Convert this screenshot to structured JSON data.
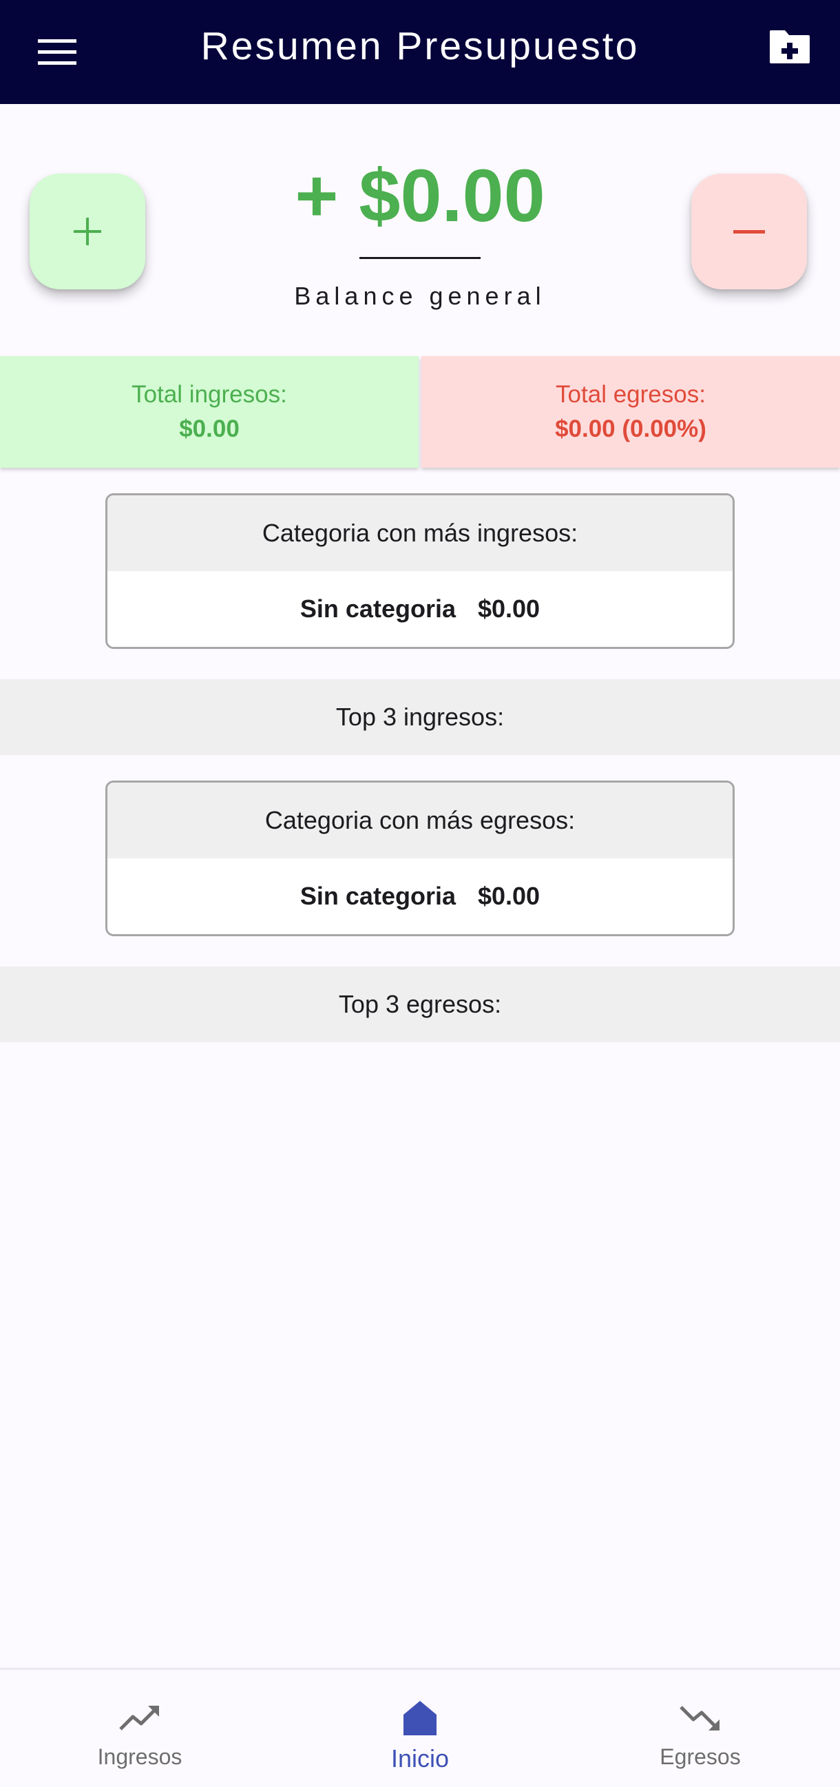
{
  "app_bar": {
    "title": "Resumen Presupuesto",
    "menu_icon": "menu-icon",
    "action_icon": "create-folder-icon",
    "background_color": "#05043a"
  },
  "balance": {
    "amount": "+ $0.00",
    "label": "Balance general",
    "color": "#4caf50"
  },
  "actions": {
    "add_income_symbol": "+",
    "add_expense_symbol": "−"
  },
  "totals": {
    "income_label": "Total ingresos:",
    "income_value": "$0.00",
    "expense_label": "Total egresos:",
    "expense_value": "$0.00 (0.00%)",
    "income_color": "#4caf50",
    "expense_color": "#e04b3a"
  },
  "income_category": {
    "header": "Categoria con más ingresos:",
    "name": "Sin categoria",
    "amount": "$0.00"
  },
  "top_income_label": "Top 3 ingresos:",
  "expense_category": {
    "header": "Categoria con más egresos:",
    "name": "Sin categoria",
    "amount": "$0.00"
  },
  "top_expense_label": "Top 3 egresos:",
  "bottom_nav": {
    "items": [
      {
        "label": "Ingresos",
        "icon": "trending-up-icon",
        "active": false
      },
      {
        "label": "Inicio",
        "icon": "home-icon",
        "active": true
      },
      {
        "label": "Egresos",
        "icon": "trending-down-icon",
        "active": false
      }
    ],
    "active_color": "#3f51b5"
  }
}
